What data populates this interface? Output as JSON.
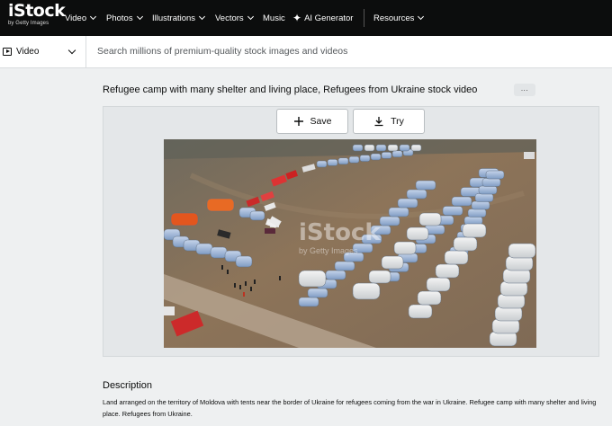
{
  "nav": {
    "logo": {
      "word": "iStock",
      "sub": "by Getty Images"
    },
    "items": [
      {
        "label": "Video",
        "has_chevron": true
      },
      {
        "label": "Photos",
        "has_chevron": true
      },
      {
        "label": "Illustrations",
        "has_chevron": true
      },
      {
        "label": "Vectors",
        "has_chevron": true
      },
      {
        "label": "Music",
        "has_chevron": false
      },
      {
        "label": "AI Generator",
        "has_chevron": false,
        "icon": "sparkle-icon"
      },
      {
        "label": "Resources",
        "has_chevron": true
      }
    ]
  },
  "search": {
    "type_label": "Video",
    "placeholder": "Search millions of premium-quality stock images and videos"
  },
  "asset": {
    "title": "Refugee camp with many shelter and living place, Refugees from Ukraine stock video",
    "more_label": "...",
    "save_label": "Save",
    "try_label": "Try",
    "watermark": "iStock",
    "watermark_sub": "by Getty Images"
  },
  "description": {
    "heading": "Description",
    "text": "Land arranged on the territory of Moldova with tents near the border of Ukraine for refugees coming from the war in Ukraine. Refugee camp with many shelter and living place. Refugees from Ukraine."
  },
  "colors": {
    "nav_bg": "#0c0d0d",
    "page_bg": "#eef0f1",
    "panel_bg": "#e4e7e9",
    "ground": "#8a6f55"
  }
}
